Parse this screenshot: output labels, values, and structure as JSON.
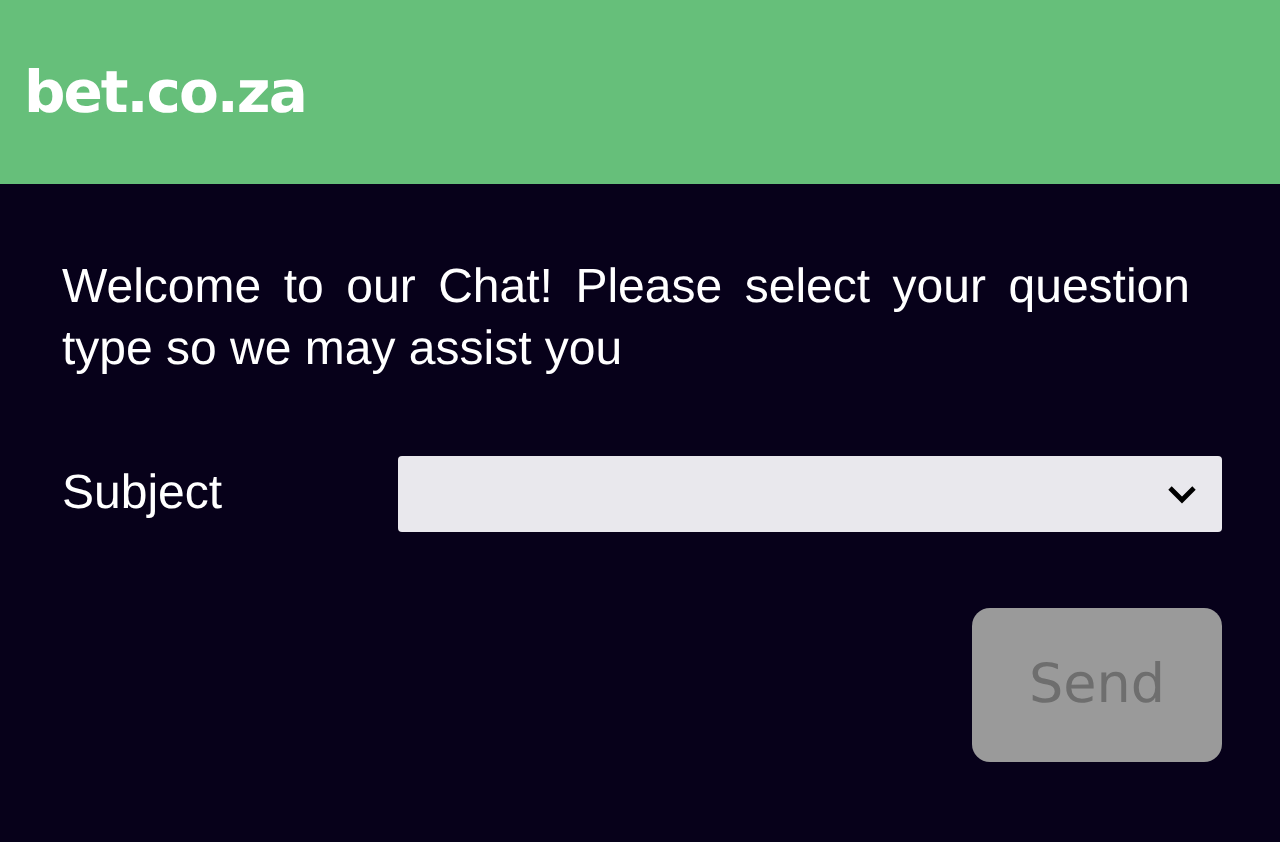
{
  "header": {
    "logo": "bet.co.za"
  },
  "intro": "Welcome to our Chat! Please select your question type so we may assist you",
  "subject": {
    "label": "Subject"
  },
  "send_button": {
    "label": "Send",
    "disabled": true
  }
}
